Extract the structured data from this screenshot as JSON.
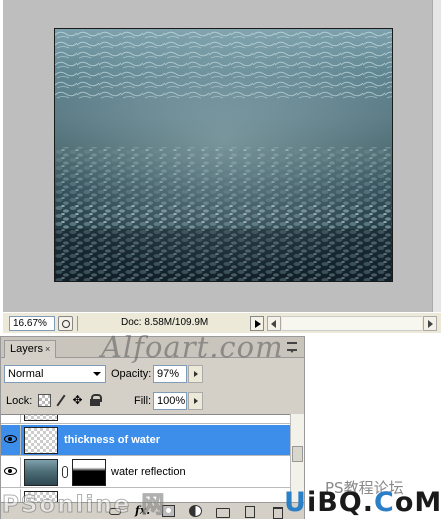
{
  "document": {
    "zoom": "16.67%",
    "doc_size": "Doc: 8.58M/109.9M",
    "image_icon": "underwater-image"
  },
  "layers_panel": {
    "tab_label": "Layers",
    "tab_close": "×",
    "blend_mode": "Normal",
    "opacity_label": "Opacity:",
    "opacity_value": "97%",
    "lock_label": "Lock:",
    "fill_label": "Fill:",
    "fill_value": "100%",
    "layers": [
      {
        "name": "thickness of water",
        "selected": true,
        "visible": true,
        "thumbnail": "transparent"
      },
      {
        "name": "water reflection",
        "selected": false,
        "visible": true,
        "thumbnail": "water",
        "has_mask": true
      }
    ],
    "bottom_buttons": [
      "link-icon",
      "fx-icon",
      "add-mask-icon",
      "adjustment-layer-icon",
      "group-icon",
      "new-layer-icon",
      "trash-icon"
    ],
    "selected_color": "#3d8eeb"
  },
  "watermarks": {
    "top": "Alfoart.com",
    "bottom_right_top": "PS教程论坛",
    "bottom_right": "UiBQ.CoM"
  }
}
